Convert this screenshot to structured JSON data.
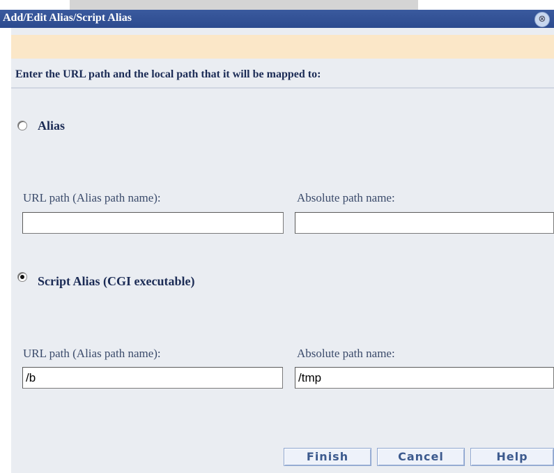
{
  "window": {
    "title": "Add/Edit Alias/Script Alias",
    "close_icon": "close-icon"
  },
  "dialog": {
    "instructions": "Enter the URL path and the local path that it will be mapped to:",
    "alias": {
      "label": "Alias",
      "selected": false,
      "url_label": "URL path (Alias path name):",
      "url_value": "",
      "abs_label": "Absolute path name:",
      "abs_value": ""
    },
    "script_alias": {
      "label": "Script Alias (CGI executable)",
      "selected": true,
      "url_label": "URL path (Alias path name):",
      "url_value": "/b",
      "abs_label": "Absolute path name:",
      "abs_value": "/tmp"
    },
    "buttons": {
      "finish": "Finish",
      "cancel": "Cancel",
      "help": "Help"
    }
  }
}
